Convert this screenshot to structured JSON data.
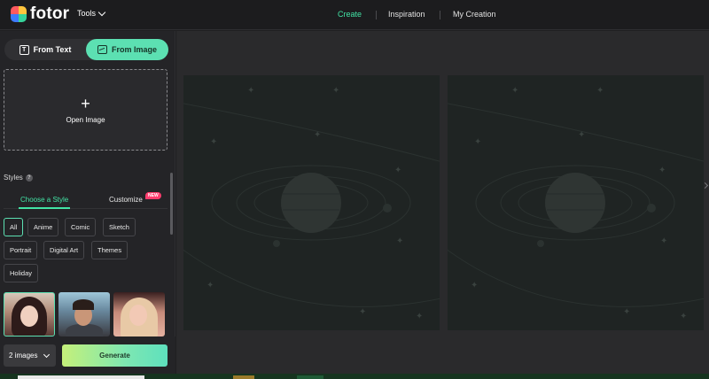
{
  "brand": {
    "name": "fotor"
  },
  "nav": {
    "tools": "Tools",
    "links": [
      "Create",
      "Inspiration",
      "My Creation"
    ],
    "accent": "#42e3a5"
  },
  "mode": {
    "from_text": "From Text",
    "from_image": "From Image",
    "active": "From Image"
  },
  "upload": {
    "label": "Open Image",
    "icon": "plus-icon"
  },
  "styles": {
    "title": "Styles",
    "tabs": [
      "Choose a Style",
      "Customize"
    ],
    "new_badge": "NEW",
    "chips": [
      "All",
      "Anime",
      "Comic",
      "Sketch",
      "Portrait",
      "Digital Art",
      "Themes",
      "Holiday"
    ],
    "selected": "All"
  },
  "footer": {
    "count": "2 images",
    "generate": "Generate"
  }
}
